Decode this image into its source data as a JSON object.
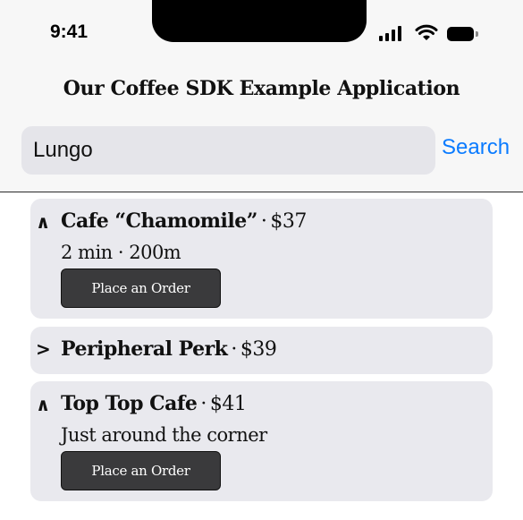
{
  "status_bar": {
    "time": "9:41"
  },
  "app": {
    "title": "Our Coffee SDK Example Application"
  },
  "search": {
    "value": "Lungo",
    "button_label": "Search"
  },
  "cafes": [
    {
      "chevron": "∧",
      "expanded": true,
      "name": "Cafe “Chamomile”",
      "separator": "·",
      "price": "$37",
      "details": "2 min · 200m",
      "order_label": "Place an Order"
    },
    {
      "chevron": ">",
      "expanded": false,
      "name": "Peripheral Perk",
      "separator": "·",
      "price": "$39"
    },
    {
      "chevron": "∧",
      "expanded": true,
      "name": "Top Top Cafe",
      "separator": "·",
      "price": "$41",
      "details": "Just around the corner",
      "order_label": "Place an Order"
    }
  ],
  "colors": {
    "accent": "#0a7bff",
    "card_bg": "#e9e9ee",
    "button_bg": "#3a3a3c"
  },
  "icons": {
    "signal": "cellular-signal-icon",
    "wifi": "wifi-icon",
    "battery": "battery-icon"
  }
}
